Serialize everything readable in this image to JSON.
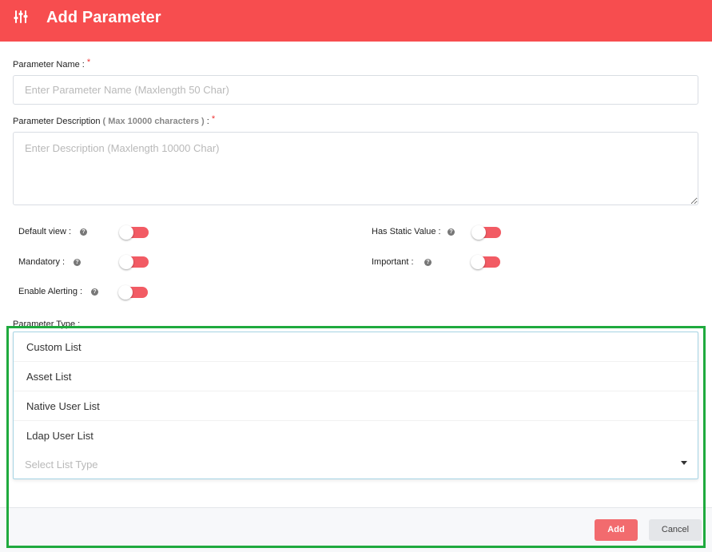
{
  "header": {
    "title": "Add Parameter",
    "icon": "sliders-icon",
    "color": "#f74d4f"
  },
  "form": {
    "name_label": "Parameter Name :",
    "name_required": "*",
    "name_placeholder": "Enter Parameter Name (Maxlength 50 Char)",
    "desc_label": "Parameter Description",
    "desc_hint": "( Max 10000 characters )",
    "desc_colon": " :",
    "desc_required": "*",
    "desc_placeholder": "Enter Description (Maxlength 10000 Char)",
    "toggles": {
      "default_view": {
        "label": "Default view :",
        "enabled": false
      },
      "mandatory": {
        "label": "Mandatory :",
        "enabled": false
      },
      "enable_alerting": {
        "label": "Enable Alerting :",
        "enabled": false
      },
      "has_static_value": {
        "label": "Has Static Value :",
        "enabled": false
      },
      "important": {
        "label": "Important :",
        "enabled": false
      }
    },
    "type_label": "Parameter Type :",
    "list_type": {
      "options": [
        "Custom List",
        "Asset List",
        "Native User List",
        "Ldap User List"
      ],
      "placeholder": "Select List Type"
    }
  },
  "footer": {
    "add_label": "Add",
    "cancel_label": "Cancel"
  },
  "colors": {
    "accent": "#f25b64",
    "highlight_border": "#1faa3e"
  }
}
